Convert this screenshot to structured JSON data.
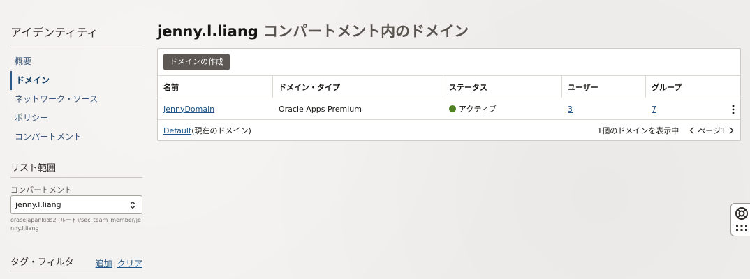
{
  "sidebar": {
    "title": "アイデンティティ",
    "nav": [
      {
        "label": "概要",
        "active": false
      },
      {
        "label": "ドメイン",
        "active": true
      },
      {
        "label": "ネットワーク・ソース",
        "active": false
      },
      {
        "label": "ポリシー",
        "active": false
      },
      {
        "label": "コンパートメント",
        "active": false
      }
    ],
    "scope": {
      "title": "リスト範囲",
      "compartment_label": "コンパートメント",
      "compartment_value": "jenny.l.liang",
      "compartment_path": "orasejapankids2 (ルート)/sec_team_member/jenny.l.liang"
    },
    "tag_filter": {
      "title": "タグ・フィルタ",
      "add_label": "追加",
      "separator": "|",
      "clear_label": "クリア"
    }
  },
  "main": {
    "title_user": "jenny.l.liang",
    "title_suffix": "コンパートメント内のドメイン",
    "create_button": "ドメインの作成",
    "table": {
      "columns": [
        "名前",
        "ドメイン・タイプ",
        "ステータス",
        "ユーザー",
        "グループ"
      ],
      "rows": [
        {
          "name": "JennyDomain",
          "type": "Oracle Apps Premium",
          "status": "アクティブ",
          "users": "3",
          "groups": "7"
        }
      ],
      "footer": {
        "default_link": "Default",
        "default_note": "(現在のドメイン)",
        "showing": "1個のドメインを表示中",
        "page_label": "ページ1"
      }
    }
  },
  "colors": {
    "link": "#1e5487",
    "status_active": "#508223",
    "button_bg": "#5d5853"
  },
  "icons": {
    "select": "chevron-up-down-icon",
    "row_actions": "kebab-menu-icon",
    "prev": "chevron-left-icon",
    "next": "chevron-right-icon",
    "help": "lifebuoy-icon",
    "apps": "grid-dots-icon"
  }
}
